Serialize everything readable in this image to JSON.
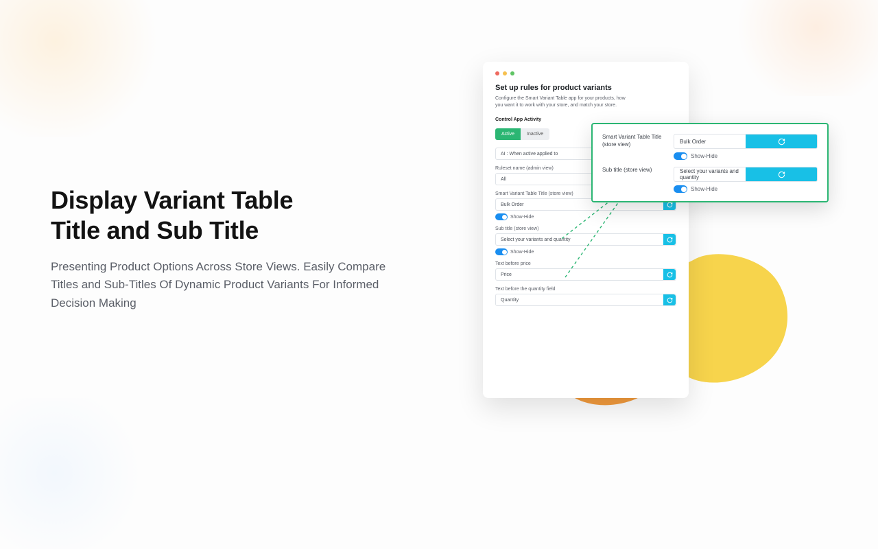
{
  "hero": {
    "title_a": "Display Variant Table",
    "title_b": "Title and Sub Title",
    "desc": "Presenting Product Options Across Store Views. Easily Compare Titles and Sub-Titles Of Dynamic Product Variants For Informed Decision Making"
  },
  "panel": {
    "title": "Set up rules for product variants",
    "desc": "Configure the Smart Variant Table app for your products, how you want it to work with your store, and match your store.",
    "control_label": "Control App Activity",
    "active": "Active",
    "inactive": "Inactive",
    "ai_input": "AI : When active applied to",
    "ruleset_label": "Ruleset name (admin view)",
    "ruleset_value": "All",
    "title_label": "Smart Variant Table Title (store view)",
    "title_value": "Bulk Order",
    "showhide": "Show-Hide",
    "subtitle_label": "Sub title (store view)",
    "subtitle_value": "Select your variants and quantity",
    "price_label": "Text before price",
    "price_value": "Price",
    "qty_label": "Text before the quantity field",
    "qty_value": "Quantity"
  },
  "callout": {
    "title_label": "Smart Variant Table Title (store view)",
    "title_value": "Bulk Order",
    "showhide": "Show-Hide",
    "subtitle_label": "Sub title (store view)",
    "subtitle_value": "Select your variants and quantity"
  }
}
